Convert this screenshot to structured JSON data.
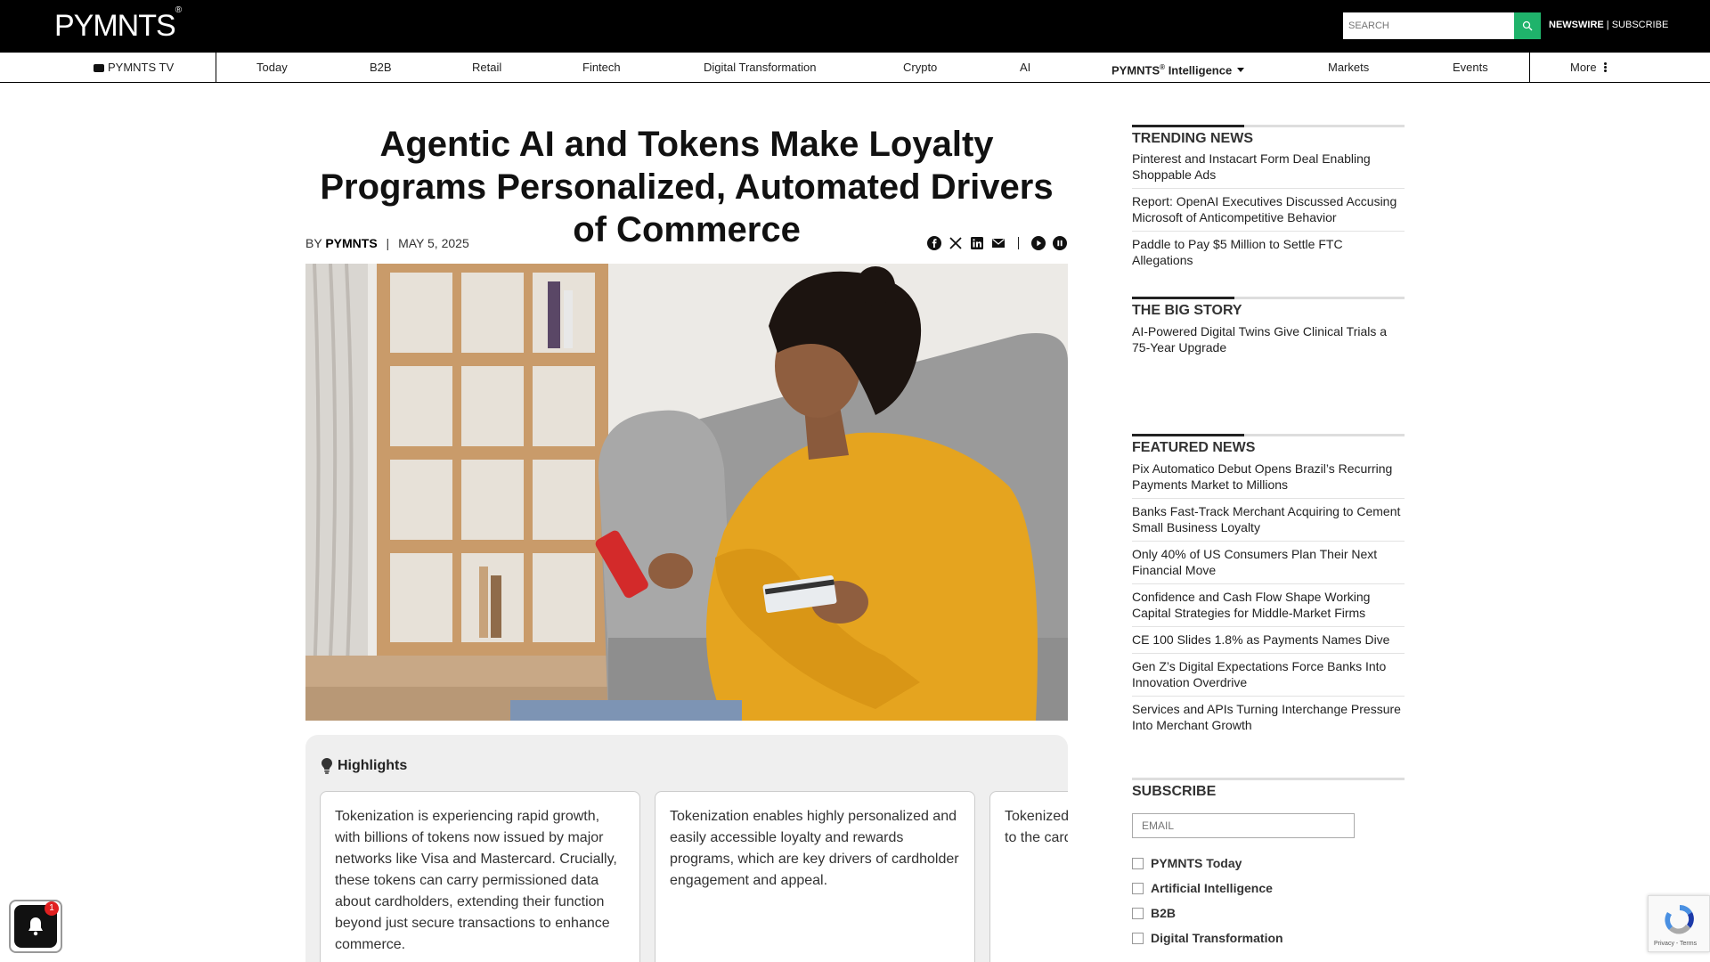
{
  "header": {
    "logo": "PYMNTS",
    "logo_mark": "®",
    "search_placeholder": "SEARCH",
    "newswire": "NEWSWIRE",
    "separator": " | ",
    "subscribe": "SUBSCRIBE"
  },
  "nav": {
    "items": [
      {
        "label": "PYMNTS TV"
      },
      {
        "label": "Today"
      },
      {
        "label": "B2B"
      },
      {
        "label": "Retail"
      },
      {
        "label": "Fintech"
      },
      {
        "label": "Digital Transformation"
      },
      {
        "label": "Crypto"
      },
      {
        "label": "AI"
      },
      {
        "label": "PYMNTS",
        "sup": "®",
        "suffix": " Intelligence"
      },
      {
        "label": "Markets"
      },
      {
        "label": "Events"
      },
      {
        "label": "More"
      }
    ]
  },
  "article": {
    "title": "Agentic AI and Tokens Make Loyalty Programs Personalized, Automated Drivers of Commerce",
    "by_prefix": "BY ",
    "author": "PYMNTS",
    "divider": "|",
    "date": "MAY 5, 2025",
    "share_icons": [
      "facebook-icon",
      "x-icon",
      "linkedin-icon",
      "email-icon",
      "play-icon",
      "pause-icon"
    ],
    "highlights_title": "Highlights",
    "highlights": [
      "Tokenization is experiencing rapid growth, with billions of tokens now issued by major networks like Visa and Mastercard. Crucially, these tokens can carry permissioned data about cardholders, extending their function beyond just secure transactions to enhance commerce.",
      "Tokenization enables highly personalized and easily accessible loyalty and rewards programs, which are key drivers of cardholder engagement and appeal.",
      "Tokenized become m with consu and marke to the card retailers."
    ]
  },
  "sidebar": {
    "trending_title": "TRENDING NEWS",
    "trending": [
      "Pinterest and Instacart Form Deal Enabling Shoppable Ads",
      "Report: OpenAI Executives Discussed Accusing Microsoft of Anticompetitive Behavior",
      "Paddle to Pay $5 Million to Settle FTC Allegations"
    ],
    "bigstory_title": "THE BIG STORY",
    "bigstory": [
      "AI-Powered Digital Twins Give Clinical Trials a 75-Year Upgrade"
    ],
    "featured_title": "FEATURED NEWS",
    "featured": [
      "Pix Automatico Debut Opens Brazil’s Recurring Payments Market to Millions",
      "Banks Fast-Track Merchant Acquiring to Cement Small Business Loyalty",
      "Only 40% of US Consumers Plan Their Next Financial Move",
      "Confidence and Cash Flow Shape Working Capital Strategies for Middle-Market Firms",
      "CE 100 Slides 1.8% as Payments Names Dive",
      "Gen Z’s Digital Expectations Force Banks Into Innovation Overdrive",
      "Services and APIs Turning Interchange Pressure Into Merchant Growth"
    ],
    "subscribe_title": "SUBSCRIBE",
    "email_placeholder": "EMAIL",
    "checkboxes": [
      "PYMNTS Today",
      "Artificial Intelligence",
      "B2B",
      "Digital Transformation"
    ]
  },
  "notification": {
    "badge": "1"
  },
  "recaptcha": {
    "text": "Privacy - Terms"
  },
  "colors": {
    "accent_green": "#1fb36b",
    "top_bar": "#000000"
  }
}
